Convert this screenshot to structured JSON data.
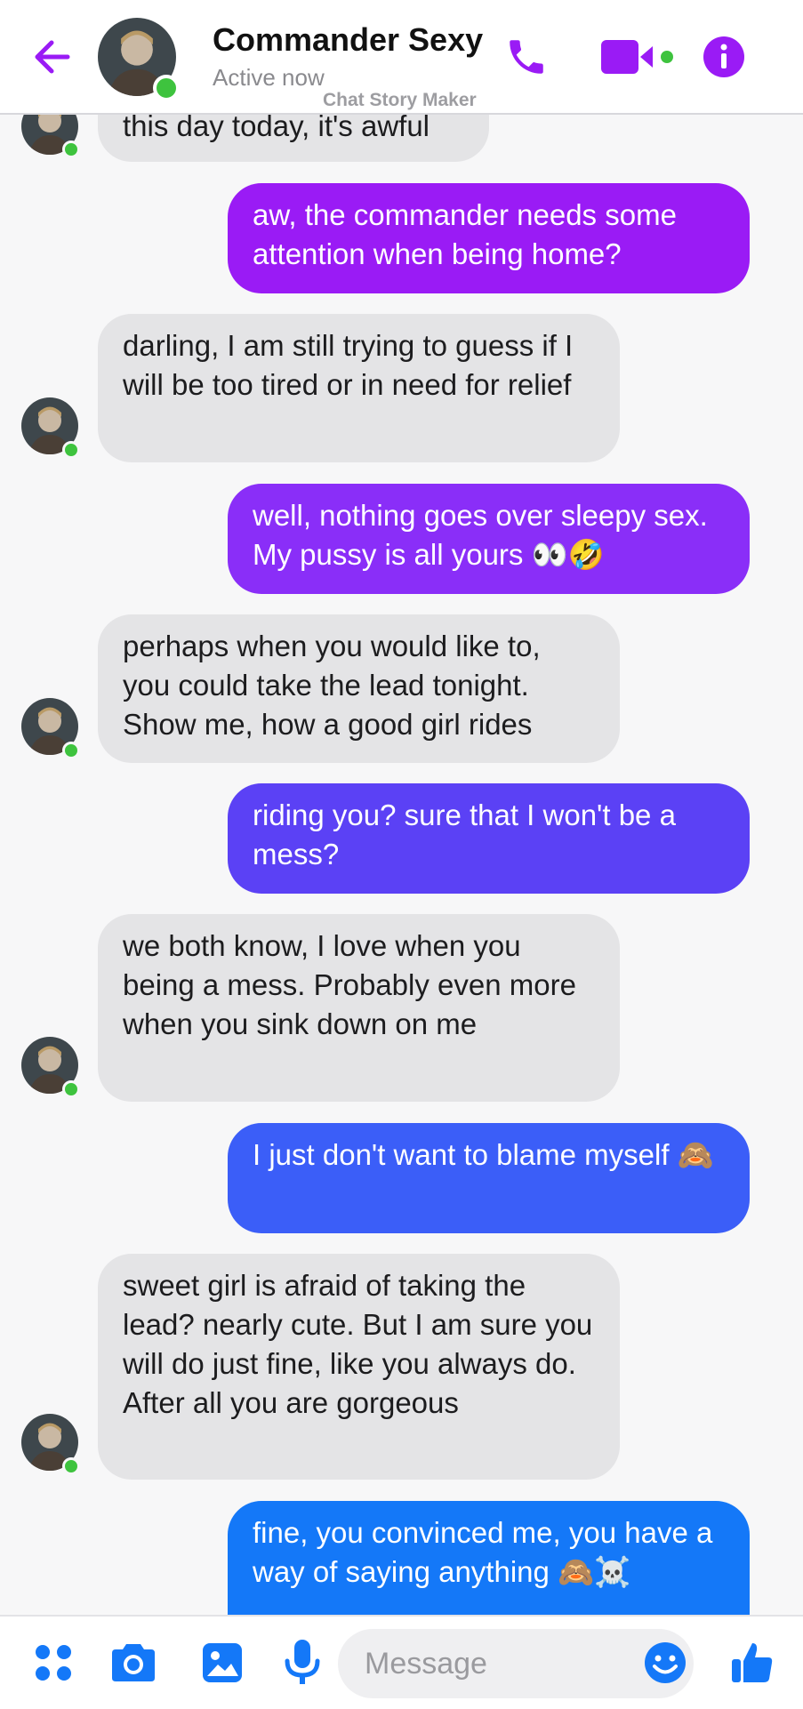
{
  "header": {
    "contact_name": "Commander Sexy",
    "status": "Active now",
    "watermark": "Chat Story Maker",
    "back_icon": "back-arrow-icon",
    "call_icon": "phone-icon",
    "video_icon": "video-camera-icon",
    "info_icon": "info-icon"
  },
  "colors": {
    "accent": "#9a1bf5",
    "online": "#3ec33e",
    "incoming_bubble": "#e4e4e6",
    "outgoing_gradient": [
      "#9a1bf5",
      "#8a2ef8",
      "#5b41f5",
      "#3b5ef8",
      "#1f72f9",
      "#1478f8"
    ]
  },
  "messages": [
    {
      "from": "them",
      "text": "this day today, it's awful"
    },
    {
      "from": "me",
      "text": "aw, the commander needs some attention when being home?"
    },
    {
      "from": "them",
      "text": "darling, I am still trying to guess if I will be too tired or in need for relief"
    },
    {
      "from": "me",
      "text": "well, nothing goes over sleepy sex. My pussy is all yours 👀🤣"
    },
    {
      "from": "them",
      "text": "perhaps when you would like to, you could take the lead tonight. Show me, how a good girl rides"
    },
    {
      "from": "me",
      "text": "riding you? sure that I won't be a mess?"
    },
    {
      "from": "them",
      "text": "we both know, I love when you being a mess. Probably even more when you sink down on me"
    },
    {
      "from": "me",
      "text": "I just don't want to blame myself 🙈"
    },
    {
      "from": "them",
      "text": "sweet girl is afraid of taking the lead? nearly cute. But I am sure you will do just fine, like you always do. After all you are gorgeous"
    },
    {
      "from": "me",
      "text": "fine, you convinced me, you have a way of saying anything 🙈☠️"
    }
  ],
  "composer": {
    "placeholder": "Message",
    "icons": [
      "apps-icon",
      "camera-icon",
      "gallery-icon",
      "microphone-icon",
      "emoji-icon",
      "thumbs-up-icon"
    ]
  }
}
